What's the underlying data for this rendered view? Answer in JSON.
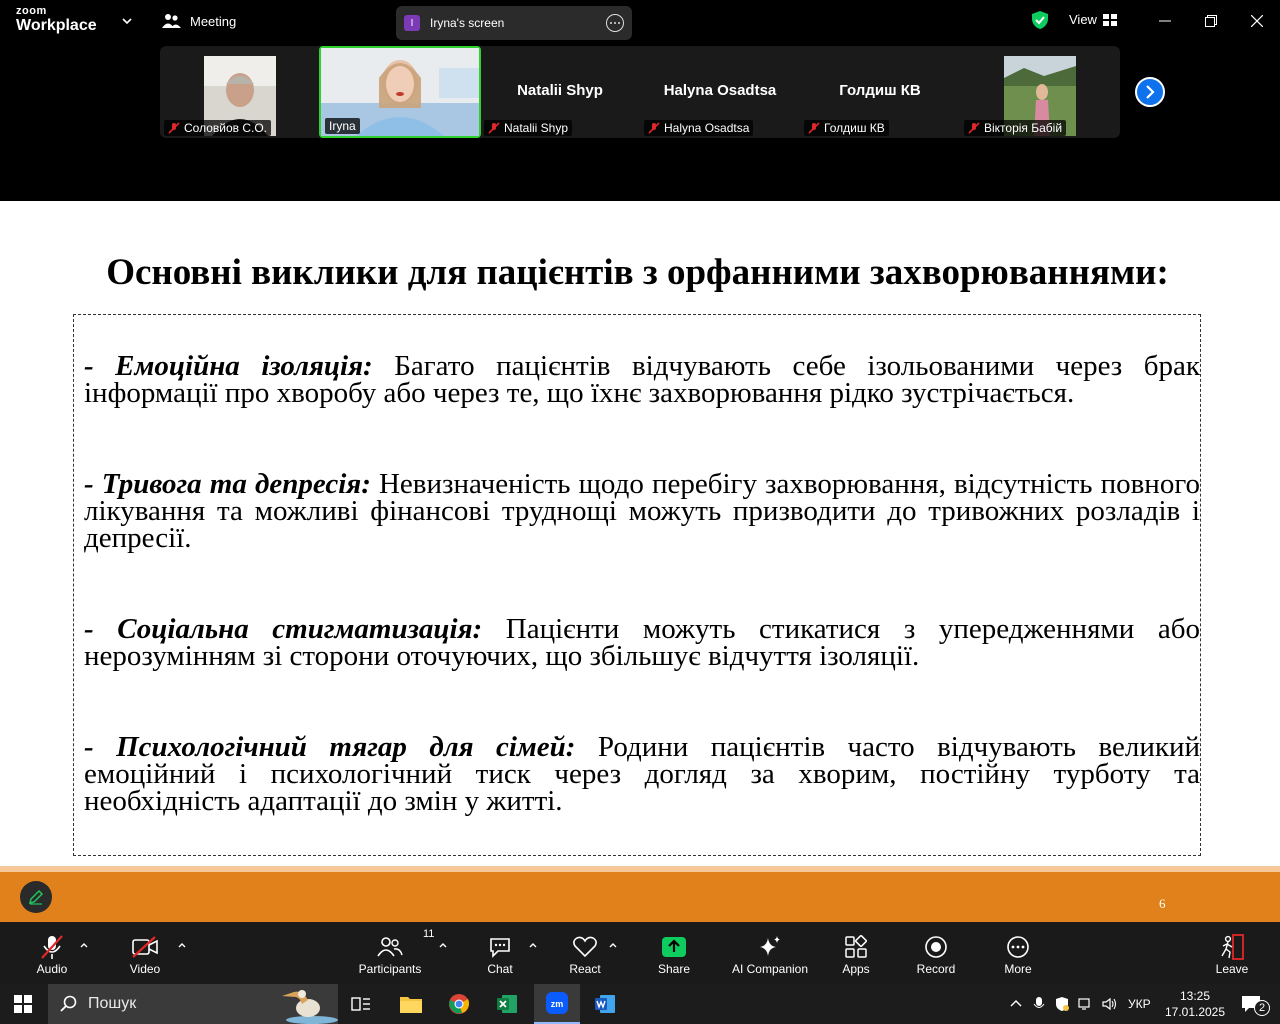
{
  "titlebar": {
    "logo_top": "zoom",
    "logo_bottom": "Workplace",
    "meeting_label": "Meeting",
    "share_title": "Iryna's screen",
    "share_avatar_letter": "I",
    "view_label": "View"
  },
  "gallery": {
    "tiles": [
      {
        "name": "Соловйов С.О.",
        "muted": true,
        "video": true
      },
      {
        "name": "Iryna",
        "muted": false,
        "video": true,
        "active": true
      },
      {
        "name": "Natalii Shyp",
        "display": "Natalii Shyp",
        "muted": true,
        "video": false
      },
      {
        "name": "Halyna Osadtsa",
        "display": "Halyna Osadtsa",
        "muted": true,
        "video": false
      },
      {
        "name": "Голдиш КВ",
        "display": "Голдиш КВ",
        "muted": true,
        "video": false
      },
      {
        "name": "Вікторія Бабій",
        "muted": true,
        "video": true
      }
    ]
  },
  "slide": {
    "title": "Основні виклики для пацієнтів з орфанними захворюваннями:",
    "points": [
      {
        "heading": "- Емоційна ізоляція:",
        "text": " Багато пацієнтів відчувають себе ізольованими через брак інформації про хворобу або через те, що їхнє захворювання рідко зустрічається."
      },
      {
        "heading": "- Тривога та депресія:",
        "text": " Невизначеність щодо перебігу захворювання, відсутність повного лікування та можливі фінансові труднощі можуть призводити до тривожних розладів і депресії."
      },
      {
        "heading": "- Соціальна стигматизація:",
        "text": " Пацієнти можуть стикатися з упередженнями або нерозумінням зі сторони оточуючих, що збільшує відчуття ізоляції."
      },
      {
        "heading": "- Психологічний тягар для сімей:",
        "text": " Родини пацієнтів часто відчувають великий емоційний і психологічний тиск через догляд за хворим, постійну турботу та необхідність адаптації до змін у житті."
      }
    ],
    "page_number": "6"
  },
  "controls": {
    "audio": "Audio",
    "video": "Video",
    "participants": "Participants",
    "participants_count": "11",
    "chat": "Chat",
    "react": "React",
    "share": "Share",
    "ai_companion": "AI Companion",
    "apps": "Apps",
    "record": "Record",
    "more": "More",
    "leave": "Leave"
  },
  "taskbar": {
    "search_placeholder": "Пошук",
    "language": "УКР",
    "time": "13:25",
    "date": "17.01.2025",
    "notifications": "2"
  },
  "colors": {
    "share_green": "#0ecc5e",
    "active_border": "#2fd12f",
    "slide_bar": "#e0811b",
    "zoom_blue": "#0e72ed",
    "mute_red": "#e02828"
  }
}
